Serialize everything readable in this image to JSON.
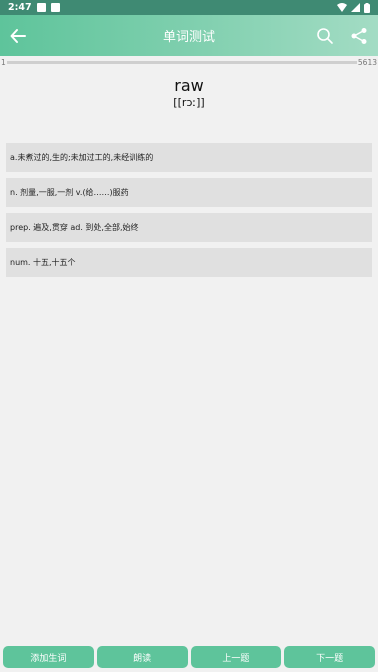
{
  "status_bar": {
    "time": "2:47"
  },
  "app_bar": {
    "title": "单词测试"
  },
  "progress": {
    "min": "1",
    "max": "5613",
    "current_fraction": 0.0
  },
  "word": {
    "text": "raw",
    "phonetic": "[[rɔː]]"
  },
  "options": [
    {
      "label": "a.未煮过的,生的;未加过工的,未经训练的"
    },
    {
      "label": "n. 剂量,一服,一剂 v.(给……)服药"
    },
    {
      "label": "prep. 遍及,贯穿 ad. 到处,全部,始终"
    },
    {
      "label": "num. 十五,十五个"
    }
  ],
  "bottom_buttons": {
    "add_word": "添加生词",
    "read": "朗读",
    "prev": "上一题",
    "next": "下一题"
  },
  "colors": {
    "accent": "#5ec49b",
    "status_bar": "#3f8a73",
    "option_bg": "#e0e0e0"
  }
}
